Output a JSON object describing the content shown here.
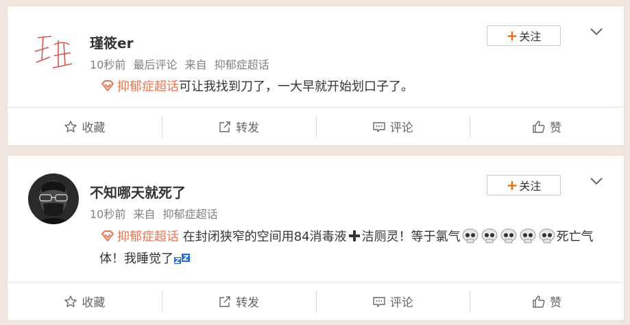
{
  "posts": [
    {
      "username": "瑾筱er",
      "meta": [
        "10秒前",
        "最后评论",
        "来自",
        "抑郁症超话"
      ],
      "follow_label": "关注",
      "topic": "抑郁症超话",
      "text": "可让我找到刀了，一大早就开始划口子了。",
      "actions": [
        "收藏",
        "转发",
        "评论",
        "赞"
      ]
    },
    {
      "username": "不知哪天就死了",
      "meta": [
        "10秒前",
        "来自",
        "抑郁症超话"
      ],
      "follow_label": "关注",
      "topic": "抑郁症超话",
      "text_1": " 在封闭狭窄的空间用84消毒液",
      "text_2": "洁厕灵！等于氯气",
      "text_3": "死亡气体！我睡觉了",
      "actions": [
        "收藏",
        "转发",
        "评论",
        "赞"
      ]
    }
  ],
  "colors": {
    "accent": "#eb7350",
    "follow_plus": "#f56a00",
    "background": "#f1e6de"
  },
  "icons": [
    "super-topic-icon",
    "star-icon",
    "forward-icon",
    "comment-icon",
    "like-icon",
    "chevron-down-icon",
    "skull-emoji",
    "plus-emoji",
    "sleep-emoji"
  ]
}
